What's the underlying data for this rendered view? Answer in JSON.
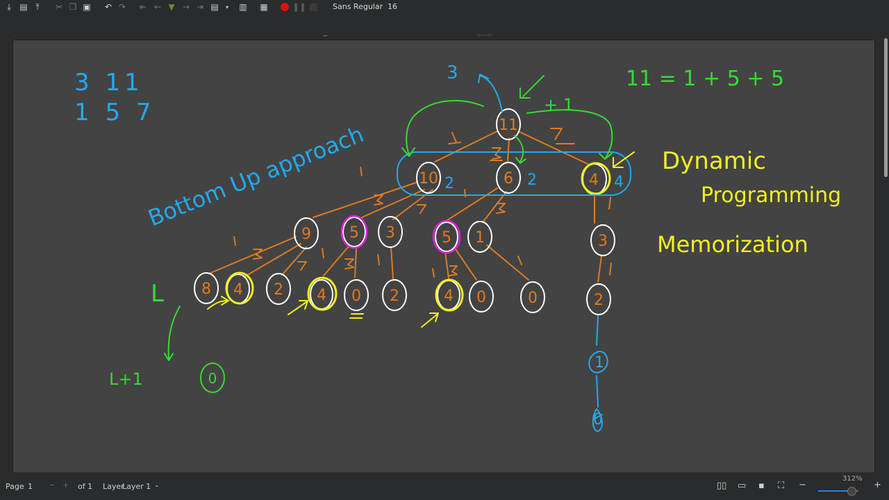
{
  "toolbar": {
    "font_name": "Sans Regular",
    "font_size": "16",
    "pen_colors": [
      "#000000",
      "#00aa00",
      "#00aaff",
      "#00cc00",
      "#2222cc",
      "#888888",
      "#ee1111",
      "#dd00dd",
      "#ff8800",
      "#ffff00",
      "#ffffff"
    ]
  },
  "notes": {
    "numbers_line1": "3 11",
    "numbers_line2": "1 5 7",
    "bottom_up": "Bottom Up approach",
    "equation": "11 = 1 + 5 + 5",
    "dp_line1": "Dynamic",
    "dp_line2": "Programming",
    "memo": "Memorization",
    "top_three": "3",
    "plus_one": "+ 1",
    "leaf_label": "L",
    "leaf_label2": "L+1",
    "count2a": "2",
    "count2b": "2",
    "count4": "4",
    "node11": "11",
    "node10": "10",
    "node6": "6",
    "node4a": "4",
    "node9": "9",
    "node5a": "5",
    "node3a": "3",
    "node5b": "5",
    "node1": "1",
    "node3b": "3",
    "node8": "8",
    "node4b": "4",
    "node2a": "2",
    "node4c": "4",
    "node0a": "0",
    "node2b": "2",
    "node4d": "4",
    "node0b": "0",
    "node0c": "0",
    "node2c": "2",
    "node1b": "1",
    "node0d": "0",
    "node0e": "0"
  },
  "status": {
    "page_label": "Page",
    "page_value": "1",
    "of_label": "of 1",
    "layer_label": "Layer",
    "layer_value": "Layer 1",
    "zoom": "312%"
  }
}
